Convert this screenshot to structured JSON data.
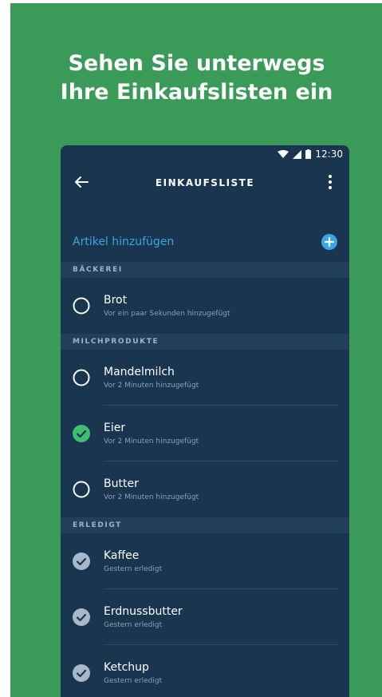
{
  "headline": {
    "line1": "Sehen Sie unterwegs",
    "line2": "Ihre Einkaufslisten ein"
  },
  "statusbar": {
    "time": "12:30",
    "icons": [
      "wifi-icon",
      "signal-icon",
      "battery-icon"
    ]
  },
  "appbar": {
    "title": "EINKAUFSLISTE",
    "back_icon": "arrow-left-icon",
    "menu_icon": "more-vertical-icon"
  },
  "add_item": {
    "label": "Artikel hinzufügen",
    "icon": "plus-circle-icon"
  },
  "sections": [
    {
      "title": "BÄCKEREI",
      "items": [
        {
          "name": "Brot",
          "subtitle": "Vor ein paar Sekunden hinzugefügt",
          "checked": false
        }
      ]
    },
    {
      "title": "MILCHPRODUKTE",
      "items": [
        {
          "name": "Mandelmilch",
          "subtitle": "Vor 2 Minuten hinzugefügt",
          "checked": false
        },
        {
          "name": "Eier",
          "subtitle": "Vor 2 Minuten hinzugefügt",
          "checked": true
        },
        {
          "name": "Butter",
          "subtitle": "Vor 2 Minuten hinzugefügt",
          "checked": false
        }
      ]
    },
    {
      "title": "ERLEDIGT",
      "items": [
        {
          "name": "Kaffee",
          "subtitle": "Gestern erledigt",
          "checked": true,
          "done": true
        },
        {
          "name": "Erdnussbutter",
          "subtitle": "Gestern erledigt",
          "checked": true,
          "done": true
        },
        {
          "name": "Ketchup",
          "subtitle": "Gestern erledigt",
          "checked": true,
          "done": true
        }
      ]
    }
  ],
  "colors": {
    "background_green": "#3a9a58",
    "phone_bg": "#1a3550",
    "section_bg": "#223f5c",
    "accent_blue": "#3aa7e0",
    "check_green": "#3dbf6e",
    "done_grey": "#a9b8c8"
  }
}
